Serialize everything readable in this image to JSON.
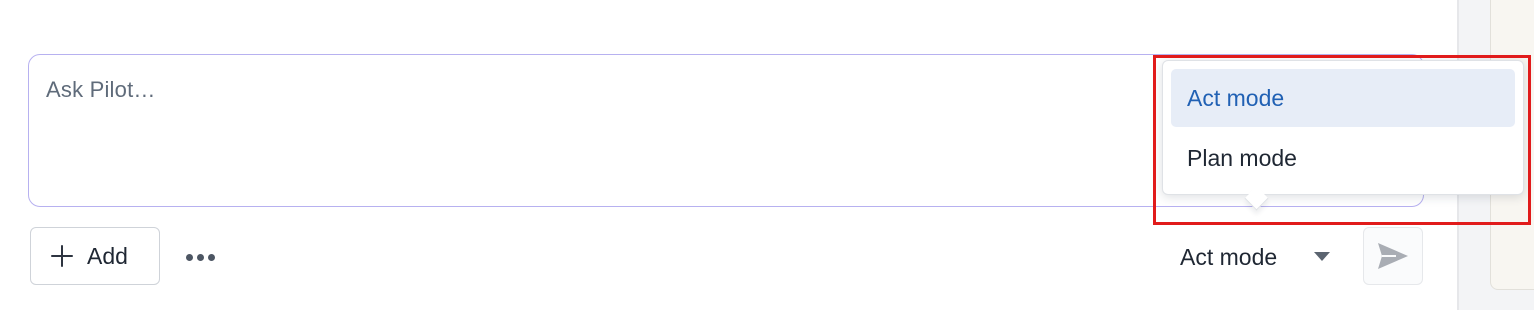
{
  "prompt": {
    "placeholder": "Ask Pilot…"
  },
  "toolbar": {
    "add_label": "Add",
    "more_icon": "more-horizontal-icon",
    "mode_selected": "Act mode",
    "send_icon": "send-icon"
  },
  "mode_menu": {
    "items": [
      {
        "label": "Act mode",
        "selected": true
      },
      {
        "label": "Plan mode",
        "selected": false
      }
    ]
  },
  "colors": {
    "accent_text": "#2161b4",
    "selected_bg": "#e7edf7",
    "input_border": "#b7b1f0",
    "highlight": "#e11b1b"
  }
}
